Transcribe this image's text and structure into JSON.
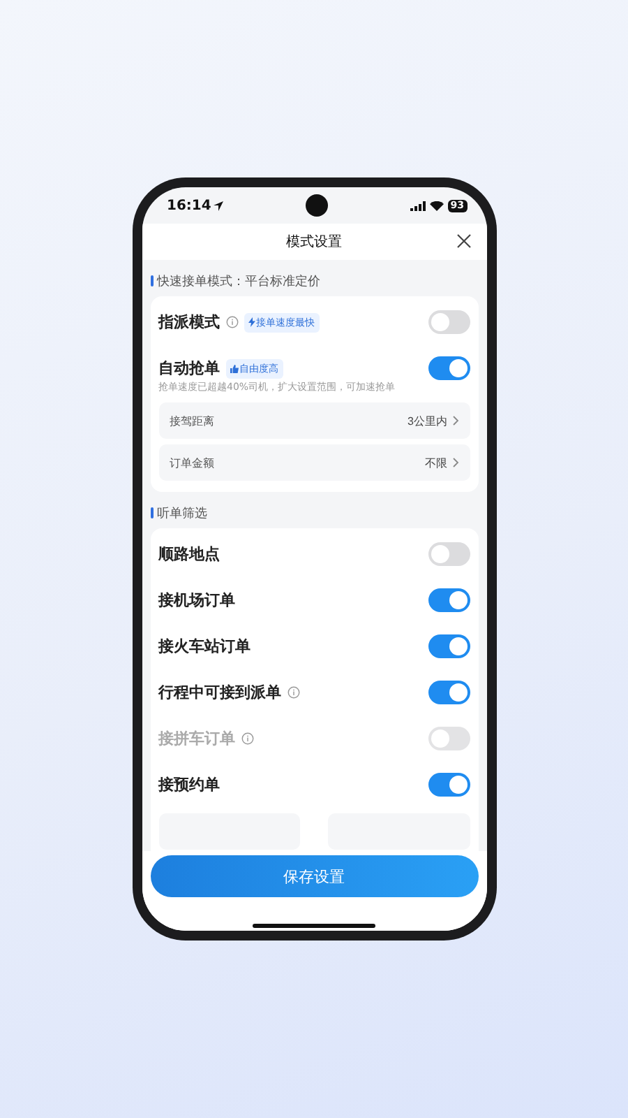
{
  "status_bar": {
    "time": "16:14",
    "battery": "93"
  },
  "header": {
    "title": "模式设置"
  },
  "sections": [
    {
      "label": "快速接单模式：平台标准定价",
      "rows": [
        {
          "kind": "toggle",
          "label": "指派模式",
          "info": true,
          "tag": "接单速度最快",
          "on": false,
          "disabled": false
        },
        {
          "kind": "toggle",
          "label": "自动抢单",
          "info": false,
          "tag": "自由度高",
          "on": true,
          "disabled": false,
          "note": "抢单速度已超越40%司机，扩大设置范围，可加速抢单"
        },
        {
          "kind": "select",
          "label": "接驾距离",
          "value": "3公里内"
        },
        {
          "kind": "select",
          "label": "订单金额",
          "value": "不限"
        }
      ]
    },
    {
      "label": "听单筛选",
      "rows": [
        {
          "kind": "toggle",
          "label": "顺路地点",
          "info": false,
          "on": false,
          "disabled": false
        },
        {
          "kind": "toggle",
          "label": "接机场订单",
          "info": false,
          "on": true,
          "disabled": false
        },
        {
          "kind": "toggle",
          "label": "接火车站订单",
          "info": false,
          "on": true,
          "disabled": false
        },
        {
          "kind": "toggle",
          "label": "行程中可接到派单",
          "info": true,
          "on": true,
          "disabled": false
        },
        {
          "kind": "toggle",
          "label": "接拼车订单",
          "info": true,
          "on": false,
          "disabled": true
        },
        {
          "kind": "toggle",
          "label": "接预约单",
          "info": false,
          "on": true,
          "disabled": false
        },
        {
          "kind": "range"
        }
      ]
    }
  ],
  "save_button": "保存设置"
}
